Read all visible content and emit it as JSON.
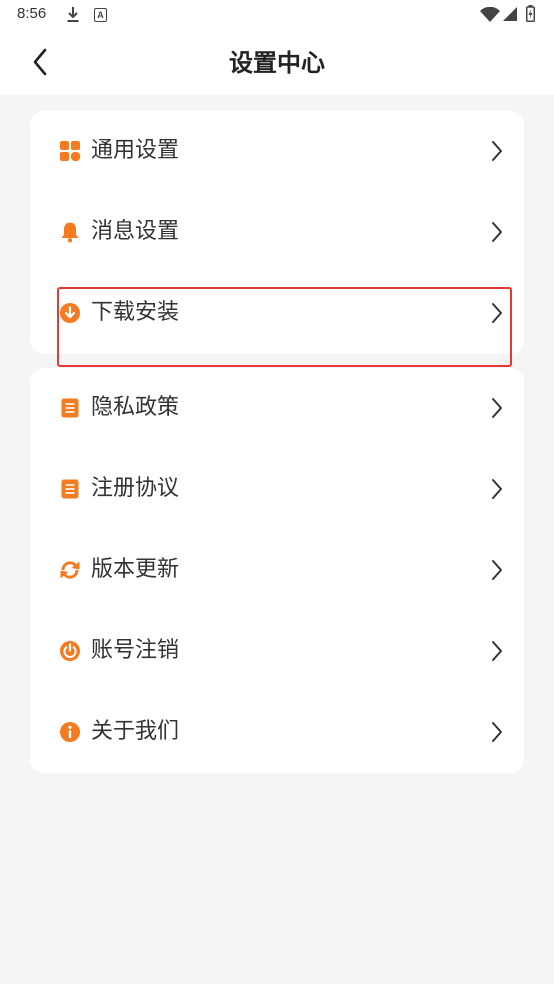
{
  "status_bar": {
    "time": "8:56",
    "notification_glyph": "A",
    "icons": [
      "download-icon",
      "a-notification-icon",
      "wifi-icon",
      "signal-icon",
      "battery-icon"
    ]
  },
  "header": {
    "title": "设置中心",
    "back_icon": "back-chevron-icon"
  },
  "groups": [
    {
      "items": [
        {
          "label": "通用设置",
          "icon": "grid-icon"
        },
        {
          "label": "消息设置",
          "icon": "bell-icon"
        },
        {
          "label": "下载安装",
          "icon": "download-circle-icon",
          "highlighted": true
        }
      ]
    },
    {
      "items": [
        {
          "label": "隐私政策",
          "icon": "document-icon"
        },
        {
          "label": "注册协议",
          "icon": "document-icon"
        },
        {
          "label": "版本更新",
          "icon": "refresh-icon"
        },
        {
          "label": "账号注销",
          "icon": "power-icon"
        },
        {
          "label": "关于我们",
          "icon": "info-icon"
        }
      ]
    }
  ],
  "colors": {
    "accent": "#F47B20",
    "highlight": "#E53935",
    "background": "#F5F5F5",
    "card": "#FFFFFF",
    "text": "#333333"
  }
}
